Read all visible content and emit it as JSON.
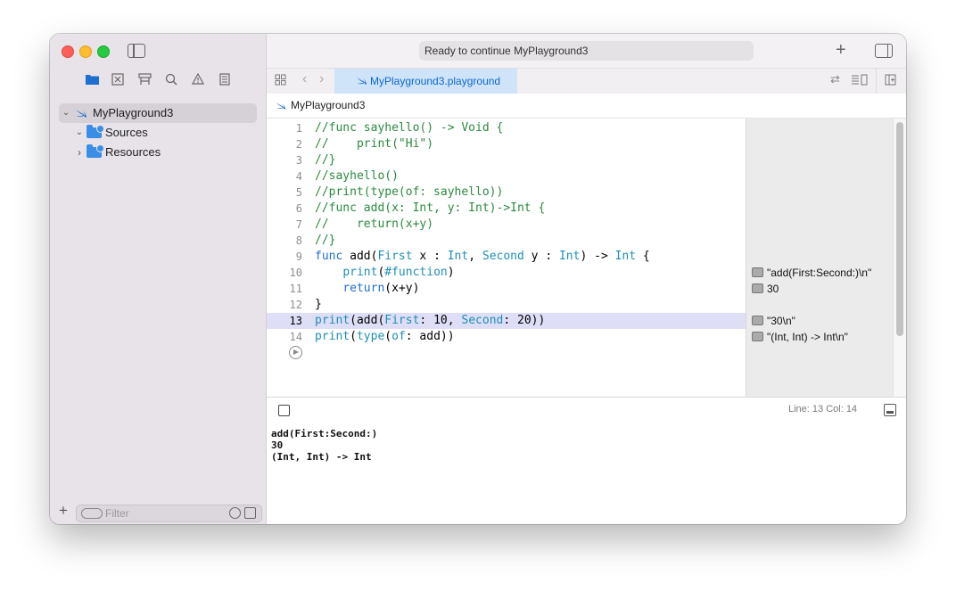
{
  "window": {
    "title": "MyPlayground3"
  },
  "toolbar": {
    "status": "Ready to continue MyPlayground3"
  },
  "tabs": [
    {
      "label": "MyPlayground3.playground"
    }
  ],
  "breadcrumb": {
    "label": "MyPlayground3"
  },
  "navigator": {
    "items": [
      {
        "label": "MyPlayground3"
      },
      {
        "label": "Sources"
      },
      {
        "label": "Resources"
      }
    ],
    "filter_placeholder": "Filter"
  },
  "editor": {
    "lines": [
      {
        "num": "1",
        "text": "//func sayhello() -> Void {"
      },
      {
        "num": "2",
        "text": "//    print(\"Hi\")"
      },
      {
        "num": "3",
        "text": "//}"
      },
      {
        "num": "4",
        "text": "//sayhello()"
      },
      {
        "num": "5",
        "text": "//print(type(of: sayhello))"
      },
      {
        "num": "6",
        "text": "//func add(x: Int, y: Int)->Int {"
      },
      {
        "num": "7",
        "text": "//    return(x+y)"
      },
      {
        "num": "8",
        "text": "//}"
      },
      {
        "num": "9",
        "text": "func add(First x : Int, Second y : Int) -> Int {"
      },
      {
        "num": "10",
        "text": "    print(#function)"
      },
      {
        "num": "11",
        "text": "    return(x+y)"
      },
      {
        "num": "12",
        "text": "}"
      },
      {
        "num": "13",
        "text": "print(add(First: 10, Second: 20))"
      },
      {
        "num": "14",
        "text": "print(type(of: add))"
      }
    ],
    "current_line": 13
  },
  "results": [
    {
      "line": 10,
      "text": "\"add(First:Second:)\\n\""
    },
    {
      "line": 11,
      "text": "30"
    },
    {
      "line": 13,
      "text": "\"30\\n\""
    },
    {
      "line": 14,
      "text": "\"(Int, Int) -> Int\\n\""
    }
  ],
  "debug": {
    "position": "Line: 13  Col: 14"
  },
  "console": {
    "lines": [
      "add(First:Second:)",
      "30",
      "(Int, Int) -> Int"
    ]
  },
  "colors": {
    "accent": "#0a67d1",
    "comment": "#2b8a3e",
    "keyword": "#1f6fd1",
    "highlight": "#dedef7"
  }
}
